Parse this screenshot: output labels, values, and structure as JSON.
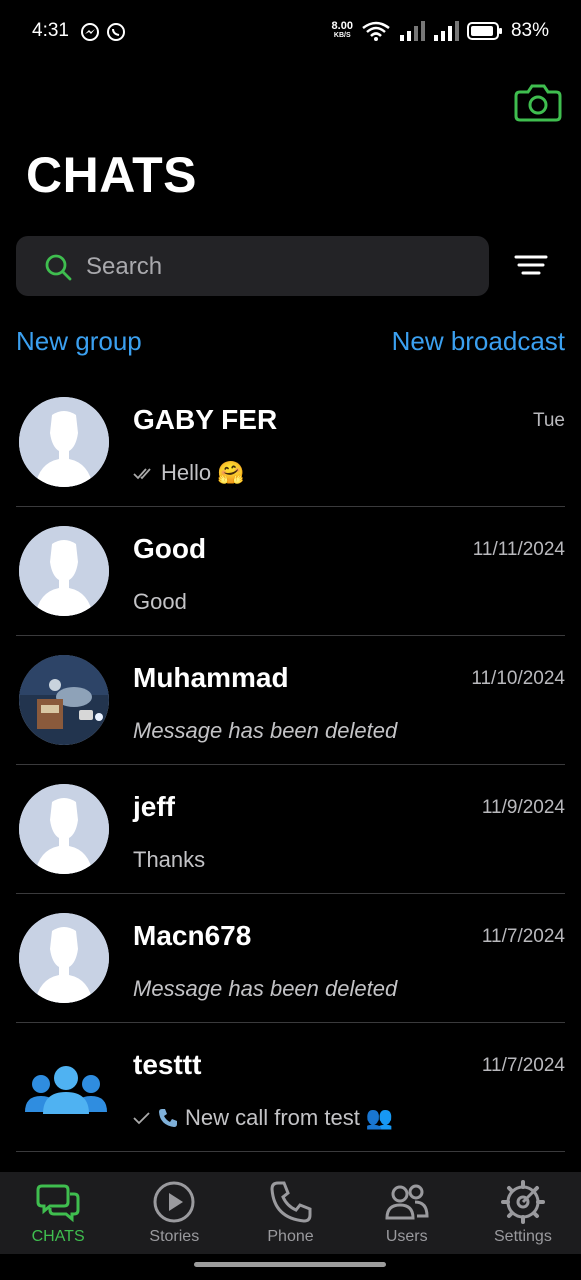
{
  "status_bar": {
    "time": "4:31",
    "net_speed": "8.00",
    "net_unit": "KB/S",
    "battery": "83%"
  },
  "header": {
    "title": "CHATS",
    "camera_icon": "camera-icon",
    "accent_color": "#3fbe4f"
  },
  "search": {
    "placeholder": "Search",
    "value": ""
  },
  "links": {
    "new_group": "New group",
    "new_broadcast": "New broadcast",
    "link_color": "#3ba0f0"
  },
  "chats": [
    {
      "name": "GABY FER",
      "date": "Tue",
      "preview": "Hello",
      "status": "double-check",
      "emoji": "🤗"
    },
    {
      "name": "Good",
      "date": "11/11/2024",
      "preview": "Good"
    },
    {
      "name": "Muhammad",
      "date": "11/10/2024",
      "preview": "Message has been deleted"
    },
    {
      "name": "jeff",
      "date": "11/9/2024",
      "preview": "Thanks"
    },
    {
      "name": "Macn678",
      "date": "11/7/2024",
      "preview": "Message has been deleted"
    },
    {
      "name": "testtt",
      "date": "11/7/2024",
      "preview": "New call from test",
      "status": "single-check",
      "emoji": "👥"
    }
  ],
  "nav": {
    "chats": "CHATS",
    "stories": "Stories",
    "phone": "Phone",
    "users": "Users",
    "settings": "Settings"
  }
}
